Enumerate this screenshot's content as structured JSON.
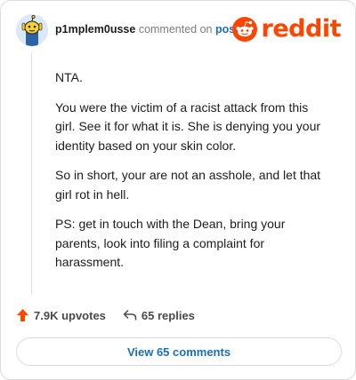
{
  "header": {
    "username": "p1mplem0usse",
    "commented_text": "commented on",
    "post_link": "post",
    "brand": "reddit"
  },
  "comment": {
    "paragraphs": [
      "NTA.",
      "You were the victim of a racist attack from this girl. See it for what it is. She is denying you your identity based on your skin color.",
      "So in short, your are not an asshole, and let that girl rot in hell.",
      "PS: get in touch with the Dean, bring your parents, look into filing a complaint for harassment."
    ]
  },
  "actions": {
    "upvotes": "7.9K upvotes",
    "replies": "65 replies"
  },
  "view_button": "View 65 comments",
  "colors": {
    "brand_orange": "#ff4500",
    "link_blue": "#1a6fb8",
    "upvote_orange": "#ff4500"
  },
  "icons": {
    "avatar": "snoo-avatar",
    "brand": "reddit-logo",
    "upvote": "upvote-arrow-icon",
    "reply": "reply-arrow-icon"
  }
}
